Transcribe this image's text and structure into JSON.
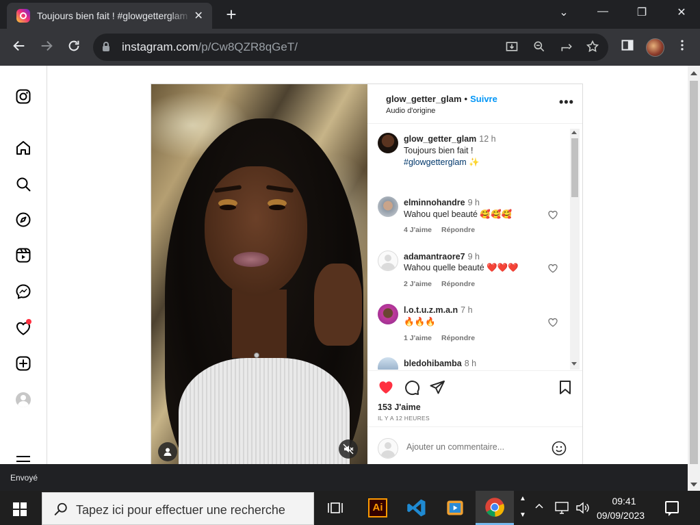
{
  "browser": {
    "tab_title": "Toujours bien fait ! #glowgetterglam",
    "tab_close": "✕",
    "new_tab": "+",
    "url_host": "instagram.com",
    "url_path": "/p/Cw8QZR8qGeT/",
    "window_controls": {
      "dropdown": "⌄",
      "minimize": "—",
      "maximize": "❐",
      "close": "✕"
    }
  },
  "post": {
    "username": "glow_getter_glam",
    "separator": "•",
    "follow_label": "Suivre",
    "audio_label": "Audio d'origine",
    "more_label": "•••",
    "caption": {
      "username": "glow_getter_glam",
      "time": "12 h",
      "text": "Toujours bien fait !",
      "hashtag": "#glowgetterglam",
      "emoji": "✨"
    },
    "comments": [
      {
        "username": "elminnohandre",
        "time": "9 h",
        "text": "Wahou quel beauté 🥰🥰🥰",
        "likes": "4 J'aime",
        "reply": "Répondre"
      },
      {
        "username": "adamantraore7",
        "time": "9 h",
        "text": "Wahou quelle beauté ❤️❤️❤️",
        "likes": "2 J'aime",
        "reply": "Répondre"
      },
      {
        "username": "l.o.t.u.z.m.a.n",
        "time": "7 h",
        "text": "🔥🔥🔥",
        "likes": "1 J'aime",
        "reply": "Répondre"
      },
      {
        "username": "bledohibamba",
        "time": "8 h",
        "text": "",
        "likes": "",
        "reply": ""
      }
    ],
    "likes_count": "153 J'aime",
    "posted_ago": "IL Y A 12 HEURES",
    "comment_placeholder": "Ajouter un commentaire..."
  },
  "download_bar": {
    "status": "Envoyé"
  },
  "taskbar": {
    "search_placeholder": "Tapez ici pour effectuer une recherche",
    "illustrator_label": "Ai",
    "time": "09:41",
    "date": "09/09/2023"
  },
  "colors": {
    "accent_blue": "#0095f6",
    "like_red": "#ff3040",
    "chrome_dark": "#202124"
  }
}
